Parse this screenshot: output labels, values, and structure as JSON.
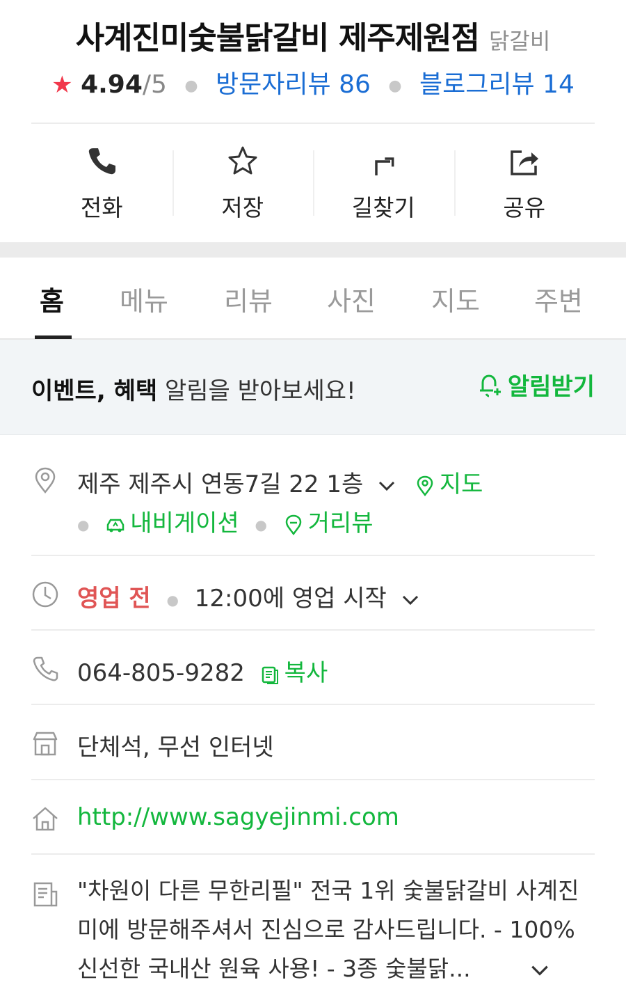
{
  "header": {
    "title": "사계진미숯불닭갈비 제주제원점",
    "category": "닭갈비",
    "rating_star": "★",
    "rating": "4.94",
    "rating_max": "/5",
    "visitor_reviews": "방문자리뷰 86",
    "blog_reviews": "블로그리뷰 14"
  },
  "actions": [
    {
      "label": "전화",
      "icon": "phone-icon"
    },
    {
      "label": "저장",
      "icon": "star-outline-icon"
    },
    {
      "label": "길찾기",
      "icon": "directions-icon"
    },
    {
      "label": "공유",
      "icon": "share-icon"
    }
  ],
  "tabs": [
    {
      "label": "홈",
      "active": true
    },
    {
      "label": "메뉴"
    },
    {
      "label": "리뷰"
    },
    {
      "label": "사진"
    },
    {
      "label": "지도"
    },
    {
      "label": "주변"
    }
  ],
  "notice": {
    "bold": "이벤트, 혜택",
    "text": " 알림을 받아보세요!",
    "button": "알림받기"
  },
  "info": {
    "address": "제주 제주시 연동7길 22 1층",
    "map_link": "지도",
    "navigation_link": "내비게이션",
    "streetview_link": "거리뷰",
    "status": "영업 전",
    "hours": "12:00에 영업 시작",
    "phone": "064-805-9282",
    "copy_label": "복사",
    "amenities": "단체석, 무선 인터넷",
    "website": "http://www.sagyejinmi.com",
    "description": "\"차원이 다른 무한리필\" 전국 1위 숯불닭갈비 사계진미에 방문해주셔서 진심으로 감사드립니다. - 100% 신선한 국내산 원육 사용! - 3종 숯불닭..."
  },
  "colors": {
    "accent_green": "#13b73d",
    "link_blue": "#1a6dd4",
    "star_red": "#f1384b",
    "status_red": "#e05555"
  }
}
